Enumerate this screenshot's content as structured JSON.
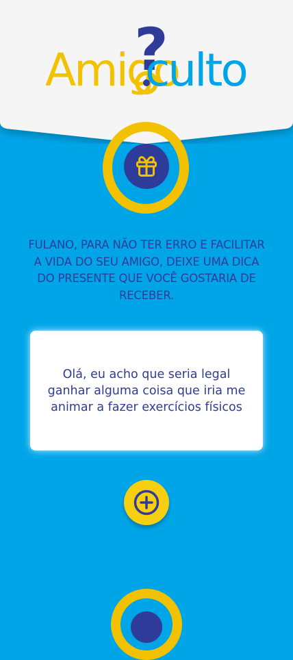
{
  "logo": {
    "part1": "Amigo",
    "part2": "culto",
    "question_mark": "?"
  },
  "icons": {
    "gift": "gift-icon",
    "add": "plus-circle-icon"
  },
  "message": "FULANO, PARA NÃO TER ERRO E FACILITAR A VIDA DO SEU AMIGO, DEIXE UMA DICA DO PRESENTE QUE VOCÊ GOSTARIA DE RECEBER.",
  "hint_card": {
    "text": "Olá, eu acho que seria legal ganhar alguma coisa que iria me animar a fazer exercícios físicos"
  },
  "colors": {
    "background": "#00a5e8",
    "header": "#f5f5f5",
    "primary_blue": "#2f3b98",
    "accent_yellow": "#f2c200"
  }
}
